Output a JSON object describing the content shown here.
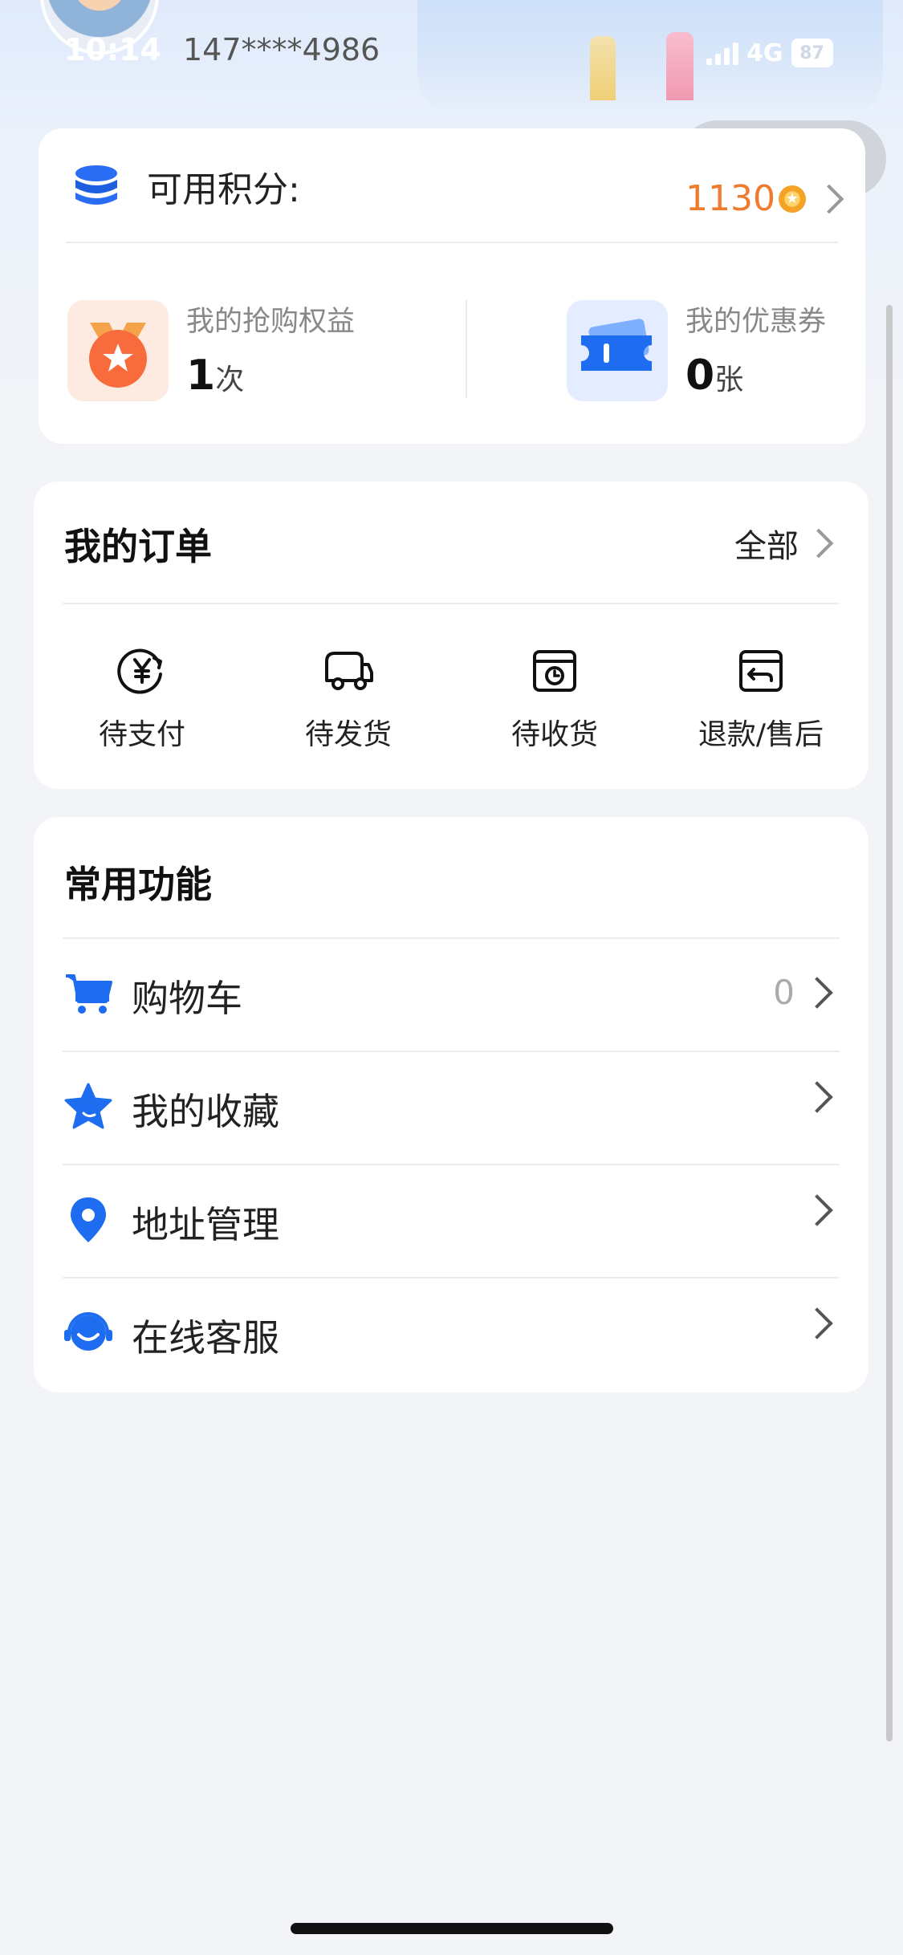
{
  "status_bar": {
    "time": "10:14",
    "network": "4G",
    "battery": "87"
  },
  "user": {
    "phone": "147****4986"
  },
  "points": {
    "label": "可用积分:",
    "value": "1130"
  },
  "benefits": [
    {
      "title": "我的抢购权益",
      "count": "1",
      "unit": "次"
    },
    {
      "title": "我的优惠券",
      "count": "0",
      "unit": "张"
    }
  ],
  "orders": {
    "title": "我的订单",
    "all_label": "全部",
    "items": [
      {
        "label": "待支付",
        "icon": "yen-circle-icon"
      },
      {
        "label": "待发货",
        "icon": "truck-icon"
      },
      {
        "label": "待收货",
        "icon": "box-clock-icon"
      },
      {
        "label": "退款/售后",
        "icon": "box-return-icon"
      }
    ]
  },
  "functions": {
    "title": "常用功能",
    "items": [
      {
        "label": "购物车",
        "count": "0",
        "icon": "cart-icon"
      },
      {
        "label": "我的收藏",
        "icon": "star-icon"
      },
      {
        "label": "地址管理",
        "icon": "location-pin-icon"
      },
      {
        "label": "在线客服",
        "icon": "headset-icon"
      }
    ]
  },
  "colors": {
    "accent": "#1e6cf0",
    "points": "#f07a2e",
    "background": "#f3f4f7"
  }
}
